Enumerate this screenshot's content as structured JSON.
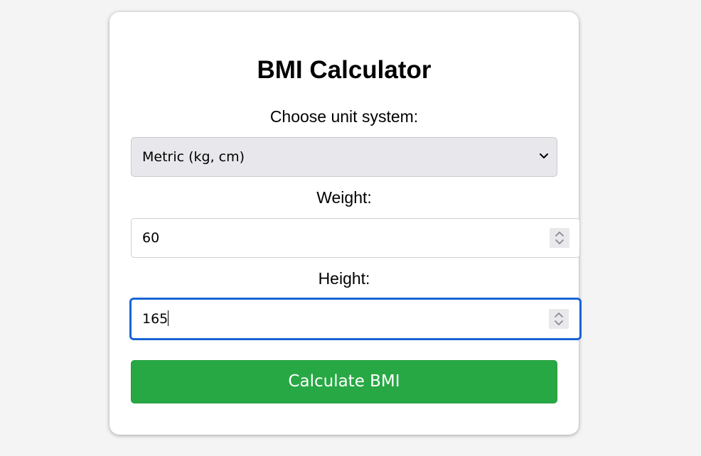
{
  "app": {
    "title": "BMI Calculator"
  },
  "form": {
    "unit_label": "Choose unit system:",
    "unit_select": {
      "selected": "Metric (kg, cm)"
    },
    "weight_label": "Weight:",
    "weight_value": "60",
    "height_label": "Height:",
    "height_value": "165",
    "submit_label": "Calculate BMI"
  },
  "colors": {
    "button_bg": "#27a844",
    "focus_border": "#1a64d4",
    "select_bg": "#e8e8ec"
  },
  "icons": {
    "select_arrow": "chevron-down-icon",
    "spinner": "spinner-arrows-icon"
  }
}
